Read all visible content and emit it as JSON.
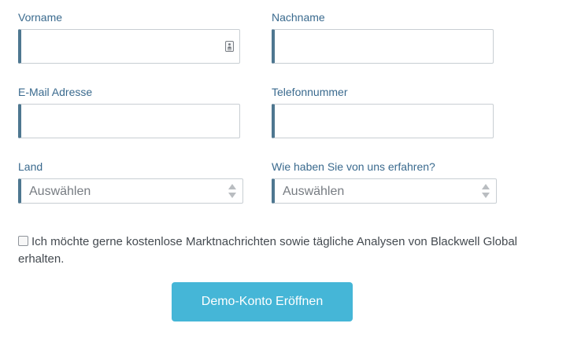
{
  "form": {
    "first_name": {
      "label": "Vorname",
      "value": ""
    },
    "last_name": {
      "label": "Nachname",
      "value": ""
    },
    "email": {
      "label": "E-Mail Adresse",
      "value": ""
    },
    "phone": {
      "label": "Telefonnummer",
      "value": ""
    },
    "country": {
      "label": "Land",
      "selected": "Auswählen"
    },
    "referral": {
      "label": "Wie haben Sie von uns erfahren?",
      "selected": "Auswählen"
    },
    "newsletter": {
      "checked": false,
      "text": "Ich möchte gerne kostenlose Marktnachrichten sowie tägliche Analysen von Blackwell Global erhalten."
    },
    "submit_label": "Demo-Konto Eröffnen"
  },
  "colors": {
    "label": "#3a6a8e",
    "field_accent": "#4e7790",
    "field_border": "#c8ced3",
    "button": "#45b6d7",
    "button_text": "#ffffff"
  }
}
